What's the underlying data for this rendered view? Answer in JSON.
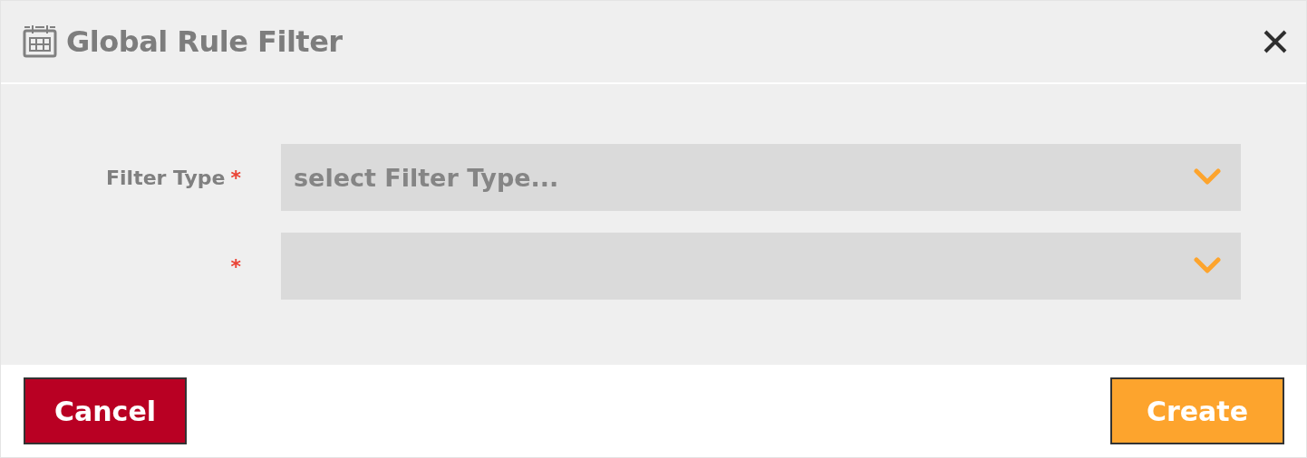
{
  "dialog": {
    "title": "Global Rule Filter"
  },
  "fields": [
    {
      "label": "Filter Type",
      "required_mark": "*",
      "placeholder": "select Filter Type..."
    },
    {
      "required_mark": "*"
    }
  ],
  "buttons": [
    {
      "label": "Cancel",
      "kind": "cancel"
    },
    {
      "label": "Create",
      "kind": "create"
    }
  ]
}
